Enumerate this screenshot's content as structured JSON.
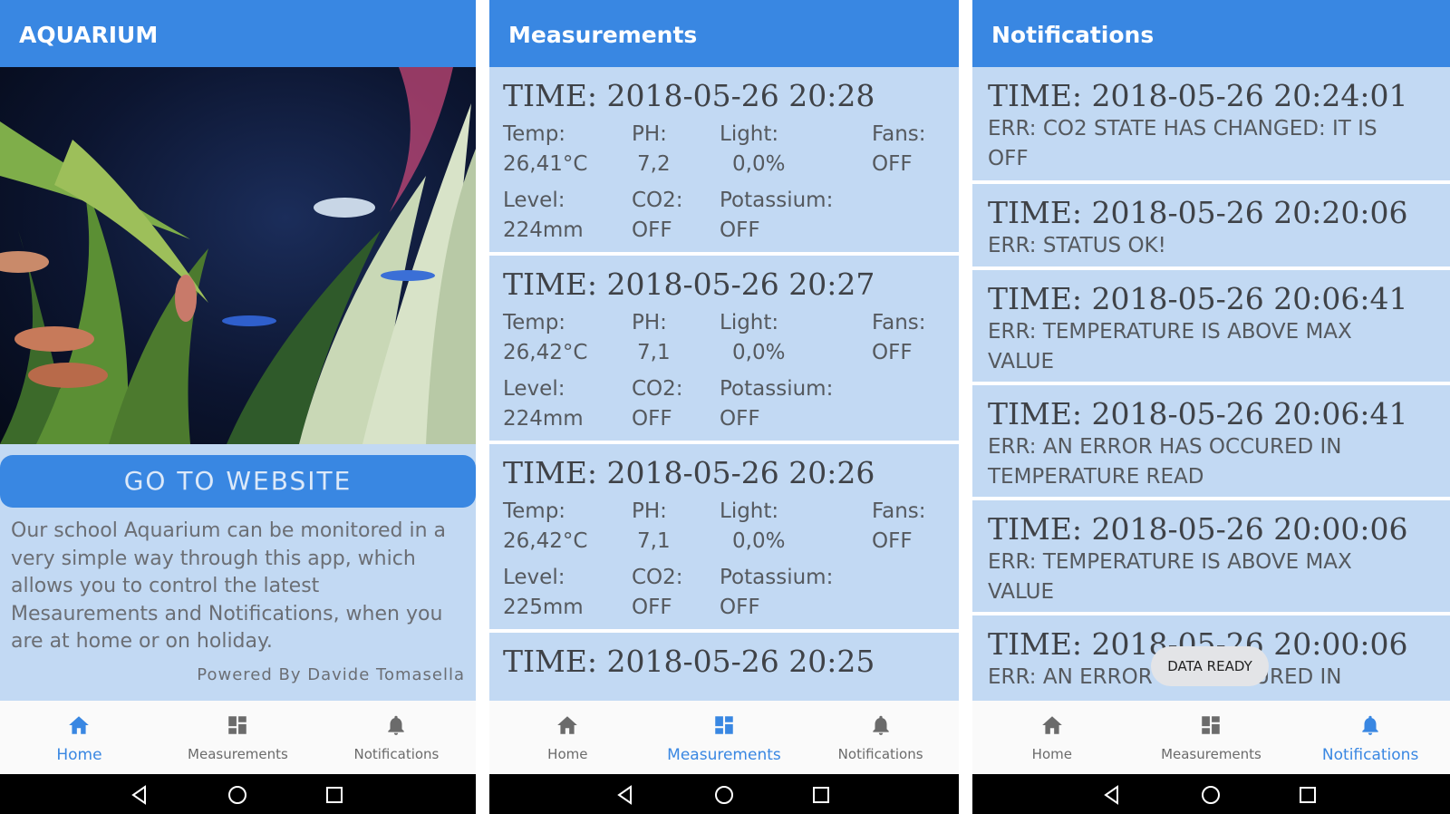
{
  "colors": {
    "accent": "#3987e2",
    "card_bg": "#c2d9f3",
    "nav_bg": "#fafafa"
  },
  "home": {
    "title": "AQUARIUM",
    "button": "GO TO WEBSITE",
    "description": "Our school Aquarium can be monitored in a very simple way through this app, which allows you to control the latest Mesaurements and Notifications, when you are at home or on holiday.",
    "powered": "Powered By Davide Tomasella"
  },
  "measurements": {
    "title": "Measurements",
    "labels": {
      "temp": "Temp:",
      "ph": "PH:",
      "light": "Light:",
      "fans": "Fans:",
      "level": "Level:",
      "co2": "CO2:",
      "potassium": "Potassium:"
    },
    "items": [
      {
        "time": "TIME: 2018-05-26 20:28",
        "temp": "26,41°C",
        "ph": "7,2",
        "light": "0,0%",
        "fans": "OFF",
        "level": "224mm",
        "co2": "OFF",
        "potassium": "OFF"
      },
      {
        "time": "TIME: 2018-05-26 20:27",
        "temp": "26,42°C",
        "ph": "7,1",
        "light": "0,0%",
        "fans": "OFF",
        "level": "224mm",
        "co2": "OFF",
        "potassium": "OFF"
      },
      {
        "time": "TIME: 2018-05-26 20:26",
        "temp": "26,42°C",
        "ph": "7,1",
        "light": "0,0%",
        "fans": "OFF",
        "level": "225mm",
        "co2": "OFF",
        "potassium": "OFF"
      },
      {
        "time": "TIME: 2018-05-26 20:25"
      }
    ]
  },
  "notifications": {
    "title": "Notifications",
    "items": [
      {
        "time": "TIME: 2018-05-26 20:24:01",
        "message": "ERR: CO2 STATE HAS CHANGED: IT IS OFF"
      },
      {
        "time": "TIME: 2018-05-26 20:20:06",
        "message": "ERR: STATUS OK!"
      },
      {
        "time": "TIME: 2018-05-26 20:06:41",
        "message": "ERR: TEMPERATURE IS ABOVE MAX VALUE"
      },
      {
        "time": "TIME: 2018-05-26 20:06:41",
        "message": "ERR: AN ERROR HAS OCCURED IN TEMPERATURE READ"
      },
      {
        "time": "TIME: 2018-05-26 20:00:06",
        "message": "ERR: TEMPERATURE IS ABOVE MAX VALUE"
      },
      {
        "time": "TIME: 2018-05-26 20:00:06",
        "message": "ERR: AN ERROR HAS OCCURED IN"
      }
    ],
    "toast": "DATA READY"
  },
  "nav": {
    "home": "Home",
    "measurements": "Measurements",
    "notifications": "Notifications"
  }
}
